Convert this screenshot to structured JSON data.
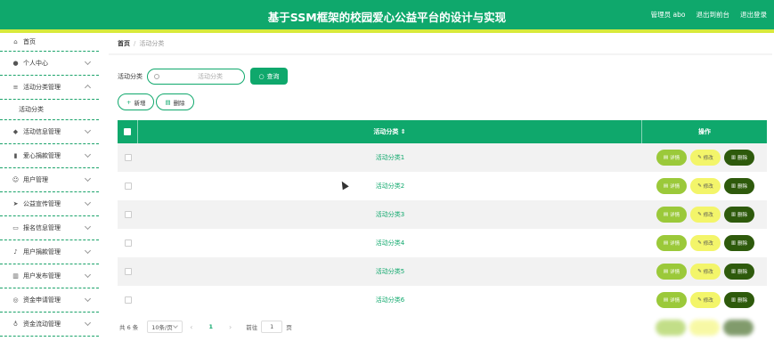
{
  "header": {
    "title": "基于SSM框架的校园爱心公益平台的设计与实现",
    "user": "管理员 abo",
    "front": "退出到前台",
    "logout": "退出登录"
  },
  "sidebar": {
    "home": "首页",
    "items": [
      {
        "label": "个人中心",
        "icon": "person-icon"
      },
      {
        "label": "活动分类管理",
        "icon": "list-icon",
        "open": true,
        "sub": "活动分类"
      },
      {
        "label": "活动信息管理",
        "icon": "pin-icon"
      },
      {
        "label": "爱心捐款管理",
        "icon": "bar-chart-icon"
      },
      {
        "label": "用户管理",
        "icon": "users-icon"
      },
      {
        "label": "公益宣传管理",
        "icon": "send-icon"
      },
      {
        "label": "报名信息管理",
        "icon": "message-icon"
      },
      {
        "label": "用户捐款管理",
        "icon": "mic-icon"
      },
      {
        "label": "用户发布管理",
        "icon": "stats-icon"
      },
      {
        "label": "资金申请管理",
        "icon": "compass-icon"
      },
      {
        "label": "资金流动管理",
        "icon": "bulb-icon"
      }
    ]
  },
  "breadcrumb": {
    "home": "首页",
    "sep": "/",
    "current": "活动分类"
  },
  "search": {
    "label": "活动分类",
    "placeholder": "活动分类",
    "button": "查询"
  },
  "actions": {
    "add": "新增",
    "delete": "删除"
  },
  "table": {
    "col_name": "活动分类",
    "col_ops": "操作",
    "rows": [
      "活动分类1",
      "活动分类2",
      "活动分类3",
      "活动分类4",
      "活动分类5",
      "活动分类6"
    ],
    "btn_detail": "详情",
    "btn_edit": "修改",
    "btn_delete": "删除"
  },
  "pager": {
    "total": "共 6 条",
    "size": "10条/页",
    "page": "1",
    "goto": "前往",
    "goto_value": "1",
    "unit": "页"
  },
  "colors": {
    "primary": "#0fa86c",
    "accent": "#d8ea3b",
    "detail": "#9bc93a",
    "edit": "#f3f56a",
    "delete": "#2e5a0c"
  }
}
